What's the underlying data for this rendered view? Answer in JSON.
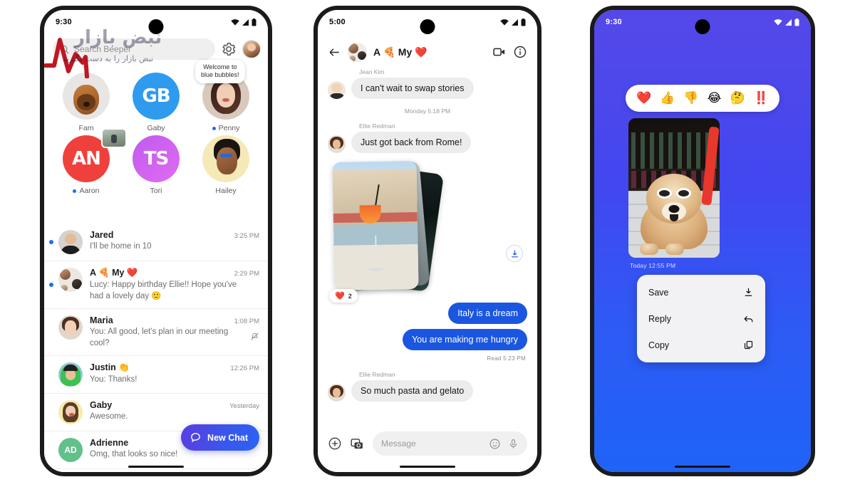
{
  "watermark": {
    "brand": "نبض بازار",
    "tagline": "نبض بازار را به دست بگیرید"
  },
  "phone1": {
    "status": {
      "time": "9:30",
      "wifi_icon": "wifi-icon",
      "signal_icon": "signal-icon",
      "battery_icon": "battery-icon"
    },
    "search": {
      "placeholder": "Search Beeper",
      "search_icon": "search-icon",
      "settings_icon": "gear-icon",
      "profile_icon": "profile-avatar"
    },
    "stories": [
      {
        "name": "Fam",
        "kind": "photo",
        "unread": false,
        "tooltip": null,
        "mono": "",
        "bg": "#e8e6e4"
      },
      {
        "name": "Gaby",
        "kind": "mono",
        "unread": false,
        "tooltip": null,
        "mono": "GB",
        "bg": "#2f9bef"
      },
      {
        "name": "Penny",
        "kind": "photo",
        "unread": true,
        "tooltip": "Welcome to\nblue bubbles!",
        "mono": "",
        "bg": "#d9c9bc"
      },
      {
        "name": "Aaron",
        "kind": "mono",
        "unread": true,
        "tooltip": null,
        "mono": "AN",
        "bg": "#f0403c"
      },
      {
        "name": "Tori",
        "kind": "mono",
        "unread": false,
        "tooltip": null,
        "mono": "TS",
        "bg": "#d05bf0"
      },
      {
        "name": "Hailey",
        "kind": "photo",
        "unread": false,
        "tooltip": null,
        "mono": "",
        "bg": "#f6e9b8"
      }
    ],
    "chats": [
      {
        "name": "Jared",
        "time": "3:25 PM",
        "preview": "I'll be home in 10",
        "unread": true,
        "muted": false,
        "initials": "",
        "avatar_bg": "#d6d2cd"
      },
      {
        "name": "A 🍕 My ❤️",
        "time": "2:29 PM",
        "preview": "Lucy: Happy birthday Ellie!! Hope you've had a lovely day  🙂",
        "unread": true,
        "muted": false,
        "initials": "",
        "avatar_bg": "#ece7e1"
      },
      {
        "name": "Maria",
        "time": "1:08 PM",
        "preview": "You: All good, let's plan in our meeting cool?",
        "unread": false,
        "muted": true,
        "initials": "",
        "avatar_bg": "#e0d6cc"
      },
      {
        "name": "Justin 👏",
        "time": "12:26 PM",
        "preview": "You: Thanks!",
        "unread": false,
        "muted": false,
        "initials": "",
        "avatar_bg": "#8fc9d6"
      },
      {
        "name": "Gaby",
        "time": "Yesterday",
        "preview": "Awesome.",
        "unread": false,
        "muted": false,
        "initials": "",
        "avatar_bg": "#f7eaa8"
      },
      {
        "name": "Adrienne",
        "time": "",
        "preview": "Omg, that looks so nice!",
        "unread": false,
        "muted": false,
        "initials": "AD",
        "avatar_bg": "#62c18a"
      }
    ],
    "fab": {
      "label": "New Chat",
      "icon": "chat-bubble-icon"
    }
  },
  "phone2": {
    "status": {
      "time": "5:00"
    },
    "header": {
      "title": "A 🍕 My ❤️",
      "back_icon": "back-arrow-icon",
      "video_icon": "video-camera-icon",
      "info_icon": "info-icon"
    },
    "messages": [
      {
        "type": "incoming",
        "sender": "Jean Kim",
        "text": "I can't wait to swap stories"
      },
      {
        "type": "daystamp",
        "text": "Monday 5:18 PM"
      },
      {
        "type": "incoming",
        "sender": "Ellie Redman",
        "text": "Just got back from Rome!"
      },
      {
        "type": "photo-stack",
        "reaction": "❤️",
        "reaction_count": "2"
      },
      {
        "type": "outgoing",
        "text": "Italy is a dream"
      },
      {
        "type": "outgoing",
        "text": "You are making me hungry"
      },
      {
        "type": "readstamp",
        "text": "Read  5:23 PM"
      },
      {
        "type": "incoming",
        "sender": "Ellie Redman",
        "text": "So much pasta and gelato"
      }
    ],
    "download_icon": "download-icon",
    "composer": {
      "placeholder": "Message",
      "plus_icon": "plus-circle-icon",
      "gallery_icon": "gallery-camera-icon",
      "emoji_icon": "emoji-icon",
      "mic_icon": "microphone-icon"
    }
  },
  "phone3": {
    "status": {
      "time": "9:30"
    },
    "reactions": [
      "❤️",
      "👍",
      "👎",
      "😂",
      "🤔",
      "‼️"
    ],
    "photo_timestamp": "Today  12:55 PM",
    "menu": [
      {
        "label": "Save",
        "icon": "download-icon"
      },
      {
        "label": "Reply",
        "icon": "reply-arrow-icon"
      },
      {
        "label": "Copy",
        "icon": "copy-icon"
      }
    ],
    "background_top": "#5548e8",
    "background_bottom": "#1f63f7"
  }
}
